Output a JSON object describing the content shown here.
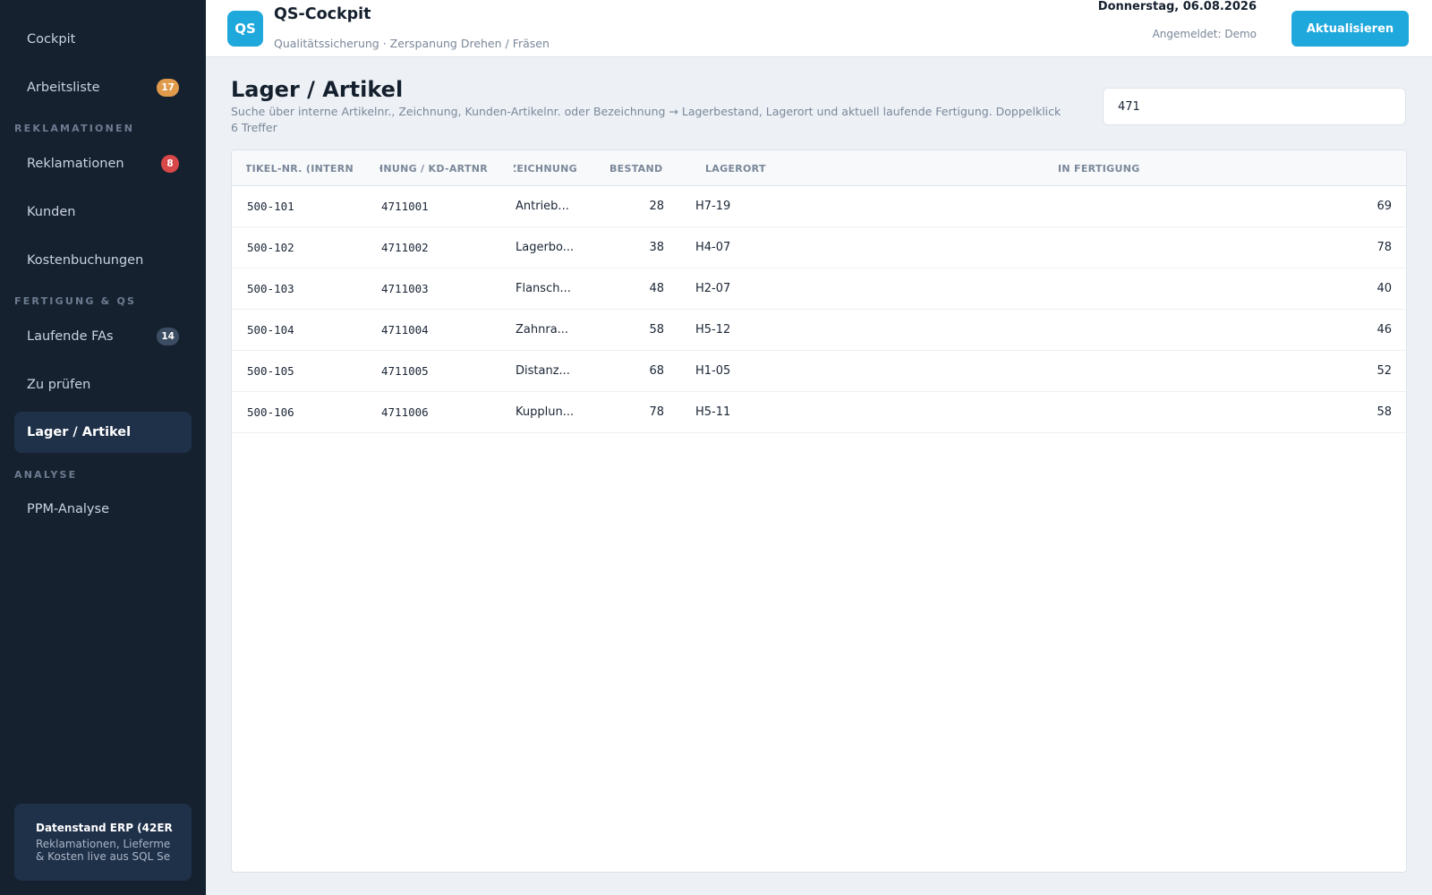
{
  "sidebar": {
    "items": [
      {
        "label": "Cockpit"
      },
      {
        "label": "Arbeitsliste",
        "badge": "17"
      },
      {
        "label": "Reklamationen",
        "badge": "8"
      },
      {
        "label": "Kunden"
      },
      {
        "label": "Kostenbuchungen"
      },
      {
        "label": "Laufende FAs",
        "badge": "14"
      },
      {
        "label": "Zu prüfen"
      },
      {
        "label": "Lager / Artikel"
      },
      {
        "label": "PPM-Analyse"
      }
    ],
    "sections": {
      "reklamationen": "REKLAMATIONEN",
      "fertigung": "FERTIGUNG & QS",
      "analyse": "ANALYSE"
    },
    "datastand": {
      "title": "Datenstand ERP (42ER",
      "text": "Reklamationen, Lieferme\n& Kosten live aus SQL Se"
    }
  },
  "header": {
    "logo": "QS",
    "title": "QS-Cockpit",
    "subtitle": "Qualitätssicherung · Zerspanung Drehen / Fräsen",
    "date": "Donnerstag, 06.08.2026",
    "user": "Angemeldet: Demo",
    "refresh_label": "Aktualisieren"
  },
  "main": {
    "title": "Lager / Artikel",
    "description": "Suche über interne Artikelnr., Zeichnung, Kunden-Artikelnr. oder Bezeichnung → Lagerbestand, Lagerort und aktuell laufende Fertigung. Doppelklick",
    "hit_count": "6 Treffer",
    "search_value": "471"
  },
  "table": {
    "columns": [
      "ARTIKEL-NR. (INTERN",
      "ZEICHNUNG / KD-ARTNR",
      "BEZEICHNUNG",
      "BESTAND",
      "LAGERORT",
      "IN FERTIGUNG"
    ],
    "rows": [
      {
        "artikel": "500-101",
        "zeichnung": "4711001",
        "bezeichnung": "Antrieb...",
        "bestand": "28",
        "lagerort": "H7-19",
        "fertigung": "69"
      },
      {
        "artikel": "500-102",
        "zeichnung": "4711002",
        "bezeichnung": "Lagerbo...",
        "bestand": "38",
        "lagerort": "H4-07",
        "fertigung": "78"
      },
      {
        "artikel": "500-103",
        "zeichnung": "4711003",
        "bezeichnung": "Flansch...",
        "bestand": "48",
        "lagerort": "H2-07",
        "fertigung": "40"
      },
      {
        "artikel": "500-104",
        "zeichnung": "4711004",
        "bezeichnung": "Zahnra...",
        "bestand": "58",
        "lagerort": "H5-12",
        "fertigung": "46"
      },
      {
        "artikel": "500-105",
        "zeichnung": "4711005",
        "bezeichnung": "Distanz...",
        "bestand": "68",
        "lagerort": "H1-05",
        "fertigung": "52"
      },
      {
        "artikel": "500-106",
        "zeichnung": "4711006",
        "bezeichnung": "Kupplun...",
        "bestand": "78",
        "lagerort": "H5-11",
        "fertigung": "58"
      }
    ]
  },
  "colors": {
    "sidebar_bg": "#16212f",
    "accent": "#1ea8dc",
    "badge_orange": "#e09a4c",
    "badge_red": "#d94848",
    "badge_dark": "#3c4d63"
  }
}
